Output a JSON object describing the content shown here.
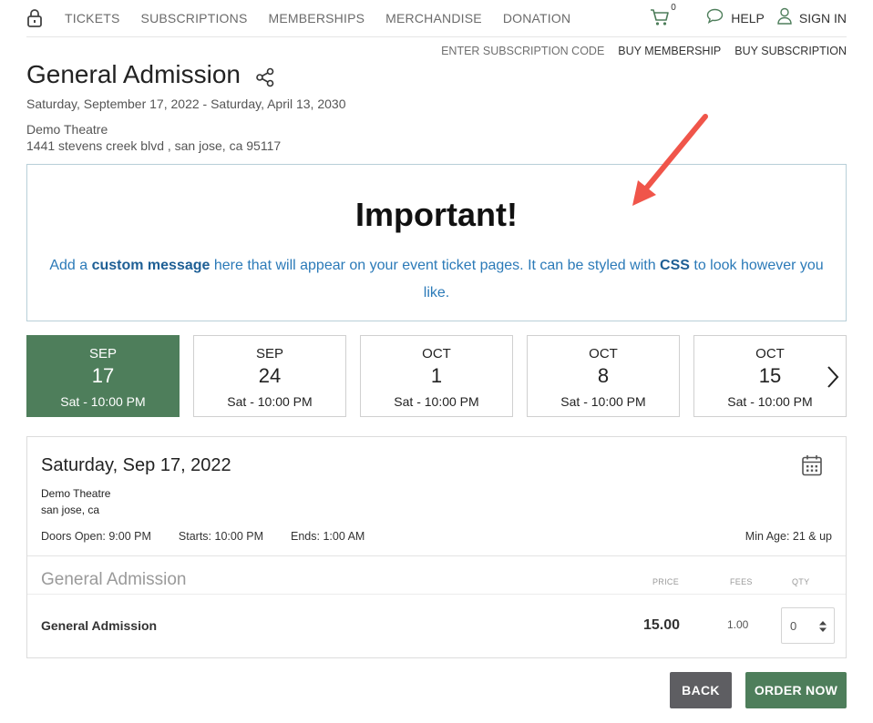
{
  "nav": {
    "links": [
      "TICKETS",
      "SUBSCRIPTIONS",
      "MEMBERSHIPS",
      "MERCHANDISE",
      "DONATION"
    ],
    "cart_count": "0",
    "help": "HELP",
    "sign_in": "SIGN IN",
    "icons": [
      "lock-icon",
      "cart-icon",
      "chat-icon",
      "user-icon"
    ]
  },
  "subnav": {
    "enter_code": "ENTER SUBSCRIPTION CODE",
    "buy_membership": "BUY MEMBERSHIP",
    "buy_subscription": "BUY SUBSCRIPTION"
  },
  "event": {
    "title": "General Admission",
    "date_range": "Saturday, September 17, 2022 - Saturday, April 13, 2030",
    "venue": "Demo Theatre",
    "address": "1441 stevens creek blvd , san jose, ca 95117"
  },
  "notice": {
    "heading": "Important!",
    "part1": "Add a ",
    "bold1": "custom message",
    "part2": " here that will appear on your event ticket pages. It can be styled with ",
    "bold2": "CSS",
    "part3": " to look however you like."
  },
  "dates": [
    {
      "month": "SEP",
      "day": "17",
      "time": "Sat - 10:00 PM",
      "selected": true
    },
    {
      "month": "SEP",
      "day": "24",
      "time": "Sat - 10:00 PM",
      "selected": false
    },
    {
      "month": "OCT",
      "day": "1",
      "time": "Sat - 10:00 PM",
      "selected": false
    },
    {
      "month": "OCT",
      "day": "8",
      "time": "Sat - 10:00 PM",
      "selected": false
    },
    {
      "month": "OCT",
      "day": "15",
      "time": "Sat - 10:00 PM",
      "selected": false
    }
  ],
  "performance": {
    "date": "Saturday, Sep 17, 2022",
    "venue": "Demo Theatre",
    "city": "san jose, ca",
    "doors": "Doors Open: 9:00 PM",
    "starts": "Starts: 10:00 PM",
    "ends": "Ends: 1:00 AM",
    "min_age": "Min Age: 21 & up"
  },
  "tickets": {
    "section": "General Admission",
    "col_price": "PRICE",
    "col_fees": "FEES",
    "col_qty": "QTY",
    "rows": [
      {
        "name": "General Admission",
        "price": "15.00",
        "fee": "1.00",
        "qty": "0"
      }
    ]
  },
  "actions": {
    "back": "BACK",
    "order": "ORDER NOW"
  },
  "colors": {
    "accent_green": "#4e7e5b",
    "back_gray": "#5e5e62",
    "link_blue": "#2b7ab8",
    "arrow_red": "#f0554a"
  }
}
